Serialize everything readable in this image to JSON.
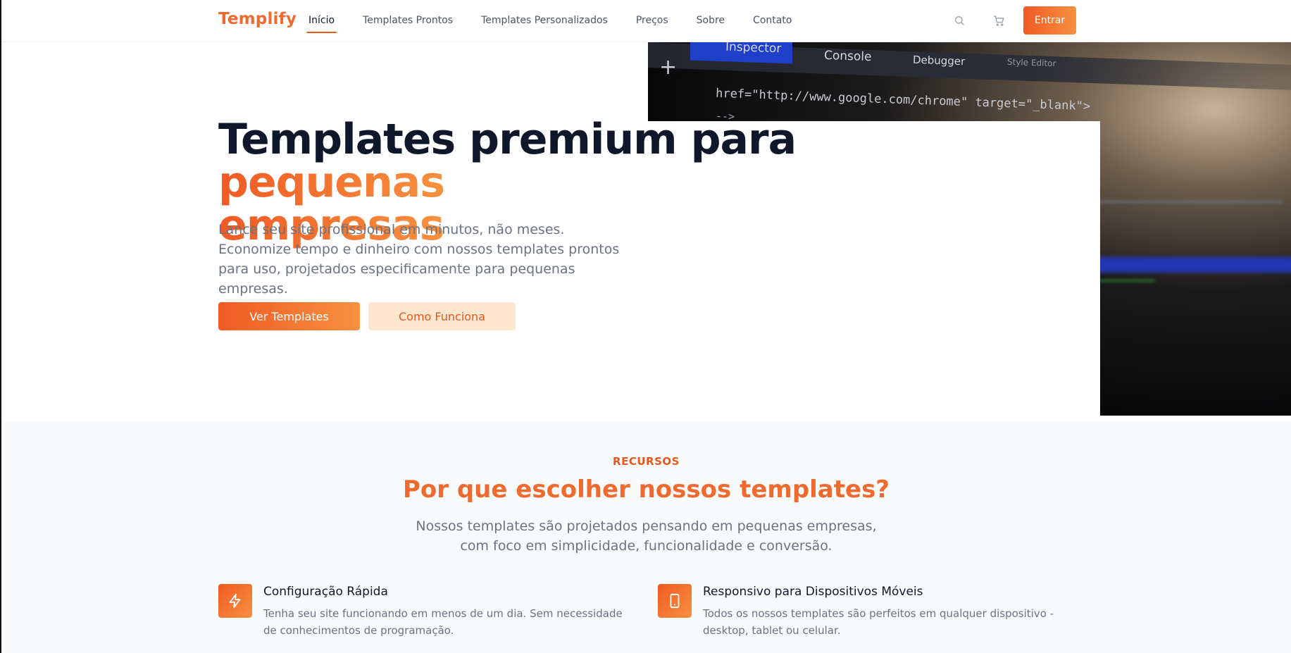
{
  "brand": {
    "logo": "Templify",
    "accent": "#f05a24",
    "accent_light": "#f7913f"
  },
  "nav": {
    "links": [
      "Início",
      "Templates Prontos",
      "Templates Personalizados",
      "Preços",
      "Sobre",
      "Contato"
    ],
    "active": "Início",
    "search_icon": "search-icon",
    "cart_icon": "cart-icon",
    "login_label": "Entrar"
  },
  "hero": {
    "title_main": "Templates premium para ",
    "title_accent_1": "pequenas",
    "title_accent_2": "empresas",
    "subtitle": "Lance seu site profissional em minutos, não meses. Economize tempo e dinheiro com nossos templates prontos para uso, projetados especificamente para pequenas empresas.",
    "primary_cta": "Ver Templates",
    "secondary_cta": "Como Funciona",
    "image": {
      "tab_inspector": "Inspector",
      "tab_console": "Console",
      "tab_debugger": "Debugger",
      "tab_style": "Style Editor",
      "code_line_1": "href=\"http://www.google.com/chrome\" target=\"_blank\">",
      "code_line_2": "-->"
    }
  },
  "features": {
    "kicker": "RECURSOS",
    "title": "Por que escolher nossos templates?",
    "subtitle": "Nossos templates são projetados pensando em pequenas empresas, com foco em simplicidade, funcionalidade e conversão.",
    "items": [
      {
        "icon": "lightning-icon",
        "title": "Configuração Rápida",
        "description": "Tenha seu site funcionando em menos de um dia. Sem necessidade de conhecimentos de programação."
      },
      {
        "icon": "smartphone-icon",
        "title": "Responsivo para Dispositivos Móveis",
        "description": "Todos os nossos templates são perfeitos em qualquer dispositivo - desktop, tablet ou celular."
      }
    ]
  }
}
